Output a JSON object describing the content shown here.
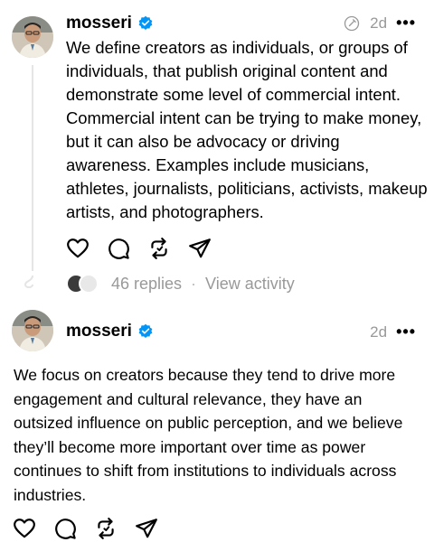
{
  "posts": [
    {
      "username": "mosseri",
      "time": "2d",
      "text": "We define creators as individuals, or groups of individuals, that publish original content and demonstrate some level of commercial intent. Commercial intent can be trying to make money, but it can also be advocacy or driving awareness. Examples include musicians, athletes, journalists, politicians, activists, makeup artists, and photographers.",
      "replies_label": "46 replies",
      "separator": "·",
      "activity_label": "View activity"
    },
    {
      "username": "mosseri",
      "time": "2d",
      "text": "We focus on creators because they tend to drive more engagement and cultural relevance, they have an outsized influence on public perception, and we believe they’ll become more important over time as power continues to shift from institutions to individuals across industries."
    }
  ],
  "icons": {
    "verified": "verified-badge-icon",
    "like": "heart-icon",
    "reply": "comment-icon",
    "repost": "repost-icon",
    "share": "send-icon",
    "more": "more-icon",
    "edited": "edit-icon"
  },
  "colors": {
    "verified": "#0095f6",
    "muted": "#999999",
    "thread_line": "#e5e5e5"
  }
}
